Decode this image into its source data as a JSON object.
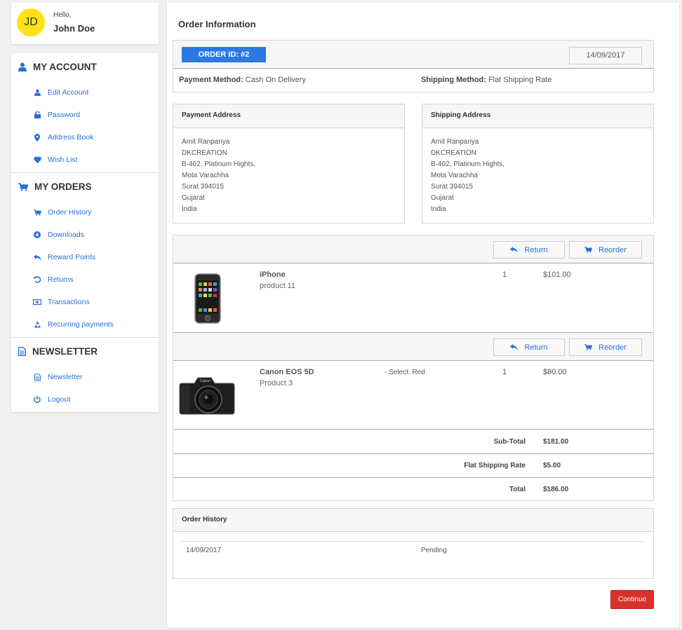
{
  "user": {
    "initials": "JD",
    "greeting": "Hello,",
    "name": "John Doe"
  },
  "sidebar": {
    "sections": [
      {
        "title": "MY ACCOUNT",
        "items": [
          {
            "label": "Edit Account",
            "icon": "user-icon"
          },
          {
            "label": "Password",
            "icon": "lock-icon"
          },
          {
            "label": "Address Book",
            "icon": "map-marker-icon"
          },
          {
            "label": "Wish List",
            "icon": "heart-icon"
          }
        ]
      },
      {
        "title": "MY ORDERS",
        "items": [
          {
            "label": "Order History",
            "icon": "cart-icon"
          },
          {
            "label": "Downloads",
            "icon": "download-icon"
          },
          {
            "label": "Reward Points",
            "icon": "reply-icon"
          },
          {
            "label": "Returns",
            "icon": "undo-icon"
          },
          {
            "label": "Transactions",
            "icon": "money-icon"
          },
          {
            "label": "Recurring payments",
            "icon": "recycle-icon"
          }
        ]
      },
      {
        "title": "NEWSLETTER",
        "items": [
          {
            "label": "Newsletter",
            "icon": "document-icon"
          },
          {
            "label": "Logout",
            "icon": "power-icon"
          }
        ]
      }
    ]
  },
  "page": {
    "title": "Order Information"
  },
  "order": {
    "id_label": "ORDER ID: #2",
    "date": "14/09/2017",
    "payment_method_label": "Payment Method:",
    "payment_method": "Cash On Delivery",
    "shipping_method_label": "Shipping Method:",
    "shipping_method": "Flat Shipping Rate"
  },
  "payment_address": {
    "title": "Payment Address",
    "lines": [
      "Amit Ranpariya",
      "DKCREATION",
      "B-402, Platinum Hights,",
      "Mota Varachha",
      "Surat 394015",
      "Gujarat",
      "India"
    ]
  },
  "shipping_address": {
    "title": "Shipping Address",
    "lines": [
      "Amit Ranpariya",
      "DKCREATION",
      "B-402, Platinum Hights,",
      "Mota Varachha",
      "Surat 394015",
      "Gujarat",
      "India"
    ]
  },
  "actions": {
    "return_label": "Return",
    "reorder_label": "Reorder"
  },
  "products": [
    {
      "name": "iPhone",
      "model": "product 11",
      "option": "",
      "quantity": "1",
      "price": "$101.00",
      "image": "phone-image"
    },
    {
      "name": "Canon EOS 5D",
      "model": "Product 3",
      "option": "- Select: Red",
      "quantity": "1",
      "price": "$80.00",
      "image": "camera-image"
    }
  ],
  "totals": [
    {
      "label": "Sub-Total",
      "value": "$181.00"
    },
    {
      "label": "Flat Shipping Rate",
      "value": "$5.00"
    },
    {
      "label": "Total",
      "value": "$186.00"
    }
  ],
  "history": {
    "title": "Order History",
    "rows": [
      {
        "date": "14/09/2017",
        "status": "Pending"
      }
    ]
  },
  "continue_label": "Continue",
  "colors": {
    "accent": "#2b77e6",
    "link": "#2a6fd6",
    "danger": "#d8302b",
    "avatar": "#ffe11a"
  }
}
